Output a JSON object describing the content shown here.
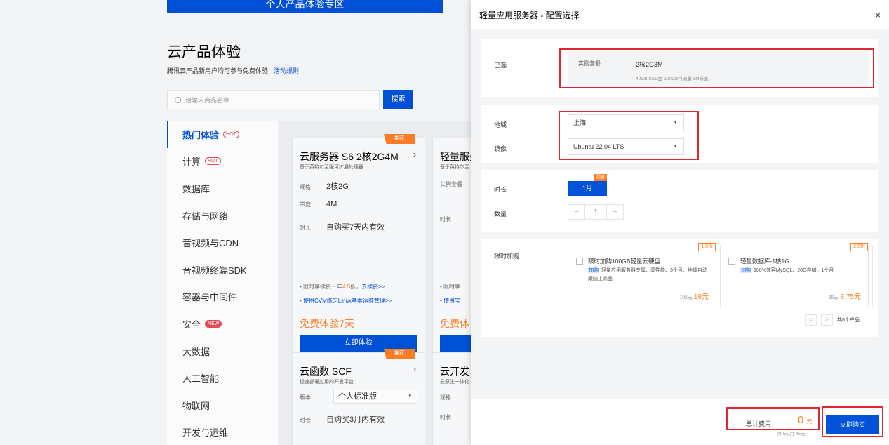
{
  "background": {
    "banner_text": "个人产品体验专区",
    "title": "云产品体验",
    "subtitle": "腾讯云产品新用户均可参与免费体验",
    "rules_link": "活动规则",
    "search_placeholder": "请输入商品名称",
    "search_button": "搜索",
    "nav": [
      {
        "label": "热门体验",
        "tag": "HOT"
      },
      {
        "label": "计算",
        "tag": "HOT"
      },
      {
        "label": "数据库",
        "tag": ""
      },
      {
        "label": "存储与网络",
        "tag": ""
      },
      {
        "label": "音视频与CDN",
        "tag": ""
      },
      {
        "label": "音视频终端SDK",
        "tag": ""
      },
      {
        "label": "容器与中间件",
        "tag": ""
      },
      {
        "label": "安全",
        "tag": "NEW"
      },
      {
        "label": "大数据",
        "tag": ""
      },
      {
        "label": "人工智能",
        "tag": ""
      },
      {
        "label": "物联网",
        "tag": ""
      },
      {
        "label": "开发与运维",
        "tag": ""
      }
    ],
    "cards": [
      {
        "badge": "推荐",
        "title": "云服务器 S6 2核2G4M",
        "sub": "基于英特尔至强可扩展处理器",
        "spec_label": "规格",
        "spec_value": "2核2G",
        "bw_label": "带宽",
        "bw_value": "4M",
        "dur_label": "时长",
        "dur_value": "自购买7天内有效",
        "bullet1_pre": "限时享续费一年",
        "bullet1_hl": "4.5",
        "bullet1_mid": "折，",
        "bullet1_link": "去续费>>",
        "bullet2": "使用CVM练习Linux基本运维管理>>",
        "free": "免费体验7天",
        "cta": "立即体验"
      },
      {
        "title": "轻量服务",
        "sub": "基于英特尔至",
        "spec_label": "实例套餐",
        "dur_label": "时长",
        "bullet1_pre": "限时享",
        "bullet2": "使用宝",
        "free": "免费体"
      },
      {
        "badge": "推荐",
        "title": "云函数 SCF",
        "sub": "极速部署应用的开发平台",
        "ver_label": "版本",
        "ver_value": "个人标准版",
        "dur_label": "时长",
        "dur_value": "自购买3月内有效"
      },
      {
        "title": "云开发",
        "sub": "云原生一体化",
        "spec_label": "规格",
        "dur_label": "时长"
      }
    ]
  },
  "drawer": {
    "title": "轻量应用服务器 - 配置选择",
    "close": "×",
    "selected": {
      "label": "已选",
      "key": "实例套餐",
      "value": "2核2G3M",
      "desc": "40GB SSD盘 200GB月流量 3M带宽"
    },
    "region": {
      "label": "地域",
      "value": "上海"
    },
    "image": {
      "label": "镜像",
      "value": "Ubuntu 22.04 LTS"
    },
    "duration": {
      "label": "时长",
      "option": "1月",
      "badge": "超值"
    },
    "quantity": {
      "label": "数量",
      "minus": "−",
      "value": "1",
      "plus": "+"
    },
    "addons": {
      "label": "限时加购",
      "items": [
        {
          "title": "限时加购100GB轻量云硬盘",
          "tag": "加购",
          "desc": "轻量应用服务器专属、高性能、3个月、地域自动跟随主商品",
          "discount": "1.8折",
          "orig": "105元",
          "price": "19元"
        },
        {
          "title": "轻量数据库-1核1G",
          "tag": "加购",
          "desc": "100%兼容MySQL、20G存储、1个月",
          "discount": "2.5折",
          "orig": "35元",
          "price": "8.75元"
        }
      ],
      "prev": "<",
      "next": ">",
      "count": "共6个产品"
    },
    "footer": {
      "total_label": "总计费用",
      "total_value": "0",
      "total_unit": "元",
      "monthly": "约0元/月",
      "monthly_orig": "45元",
      "buy": "立即购买"
    }
  }
}
